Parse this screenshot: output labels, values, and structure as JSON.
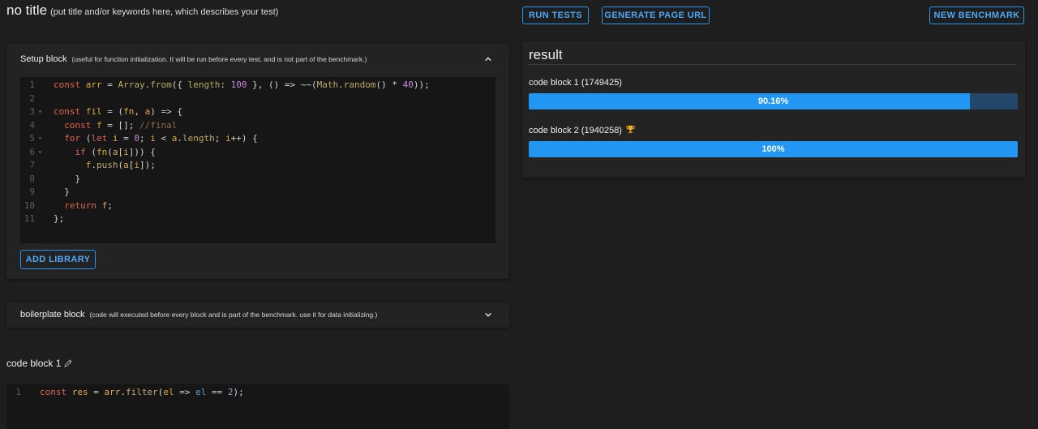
{
  "header": {
    "title": "no title",
    "title_hint": "(put title and/or keywords here, which describes your test)",
    "run_tests": "RUN TESTS",
    "generate_url": "GENERATE PAGE URL",
    "new_benchmark": "NEW BENCHMARK"
  },
  "setup": {
    "label": "Setup block",
    "hint": "(useful for function initialization. It will be run before every test, and is not part of the benchmark.)",
    "add_library": "ADD LIBRARY",
    "line_numbers": [
      "1",
      "2",
      "3",
      "4",
      "5",
      "6",
      "7",
      "8",
      "9",
      "10",
      "11"
    ],
    "fold_markers": [
      "",
      "",
      "▾",
      "",
      "▾",
      "▾",
      "",
      "",
      "",
      "",
      ""
    ]
  },
  "boilerplate": {
    "label": "boilerplate block",
    "hint": "(code will executed before every block and is part of the benchmark. use it for data initializing.)"
  },
  "codeblock1": {
    "label": "code block 1",
    "line_numbers": [
      "1"
    ]
  },
  "result": {
    "title": "result",
    "items": [
      {
        "label": "code block 1 (1749425)",
        "percent_text": "90.16%",
        "fraction": 0.9016,
        "winner": false
      },
      {
        "label": "code block 2 (1940258)",
        "percent_text": "100%",
        "fraction": 1.0,
        "winner": true
      }
    ]
  },
  "colors": {
    "accent": "#2196f3",
    "bar_track": "#24466a",
    "background": "#1e1e1e",
    "panel": "#232323",
    "editor_bg": "#161616"
  },
  "icons": {
    "collapse": "chevron-up-icon",
    "expand": "chevron-down-icon",
    "edit": "pencil-icon",
    "winner": "trophy-icon"
  }
}
